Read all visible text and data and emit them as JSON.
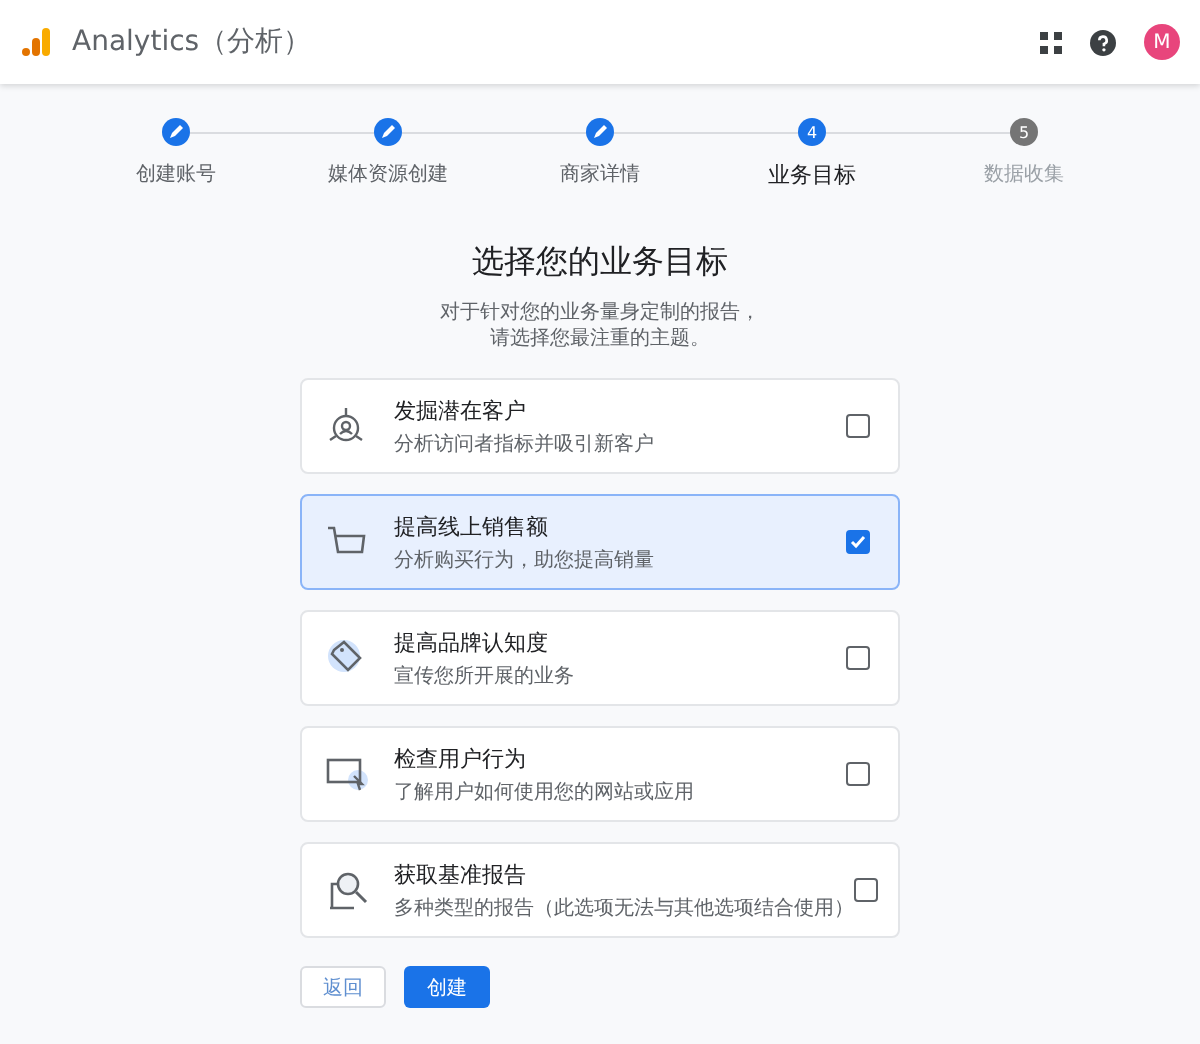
{
  "header": {
    "title": "Analytics（分析）",
    "avatar": "M"
  },
  "steps": [
    {
      "label": "创建账号",
      "completed": true,
      "current": false
    },
    {
      "label": "媒体资源创建",
      "completed": true,
      "current": false
    },
    {
      "label": "商家详情",
      "completed": true,
      "current": false
    },
    {
      "label": "业务目标",
      "completed": false,
      "current": true,
      "number": "4"
    },
    {
      "label": "数据收集",
      "completed": false,
      "current": false,
      "number": "5"
    }
  ],
  "heading": "选择您的业务目标",
  "intro": [
    "对于针对您的业务量身定制的报告，",
    "请选择您最注重的主题。"
  ],
  "options": [
    {
      "title": "发掘潜在客户",
      "subtitle": "分析访问者指标并吸引新客户",
      "checked": false
    },
    {
      "title": "提高线上销售额",
      "subtitle": "分析购买行为，助您提高销量",
      "checked": true
    },
    {
      "title": "提高品牌认知度",
      "subtitle": "宣传您所开展的业务",
      "checked": false
    },
    {
      "title": "检查用户行为",
      "subtitle": "了解用户如何使用您的网站或应用",
      "checked": false
    },
    {
      "title": "获取基准报告",
      "subtitle": "多种类型的报告（此选项无法与其他选项结合使用）",
      "checked": false
    }
  ],
  "buttons": {
    "back": "返回",
    "create": "创建"
  }
}
